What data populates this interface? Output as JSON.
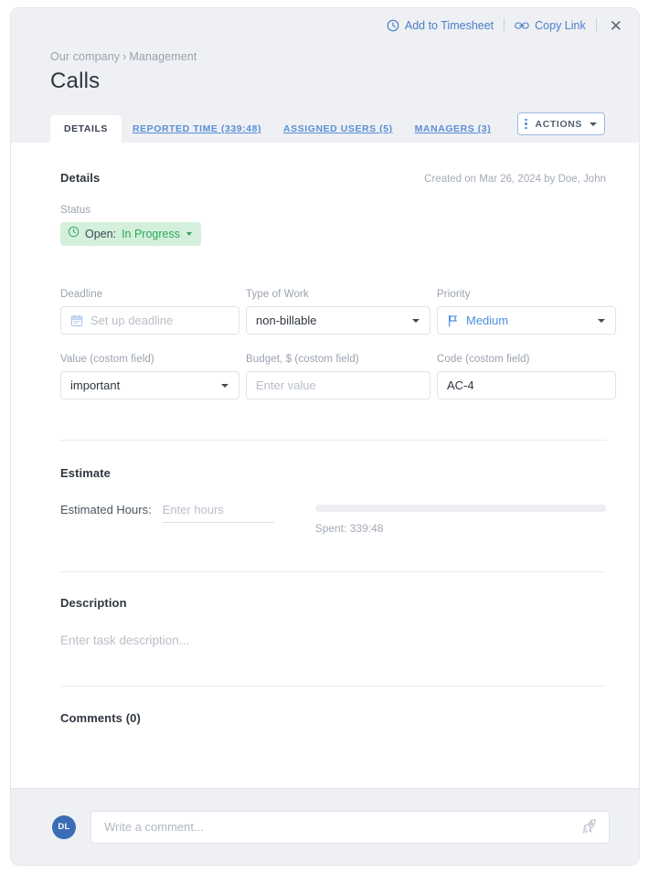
{
  "header": {
    "add_to_timesheet": "Add to Timesheet",
    "copy_link": "Copy Link",
    "close": "✕",
    "breadcrumb": {
      "root": "Our company",
      "separator": "›",
      "leaf": "Management"
    },
    "title": "Calls"
  },
  "tabs": [
    {
      "label": "DETAILS",
      "active": true
    },
    {
      "label": "REPORTED TIME (339:48)",
      "active": false
    },
    {
      "label": "ASSIGNED USERS (5)",
      "active": false
    },
    {
      "label": "MANAGERS (3)",
      "active": false
    }
  ],
  "actions_button": {
    "label": "ACTIONS"
  },
  "details": {
    "section_title": "Details",
    "created_meta": "Created on Mar 26, 2024 by Doe, John",
    "status_label": "Status",
    "status": {
      "prefix": "Open:",
      "value": "In Progress"
    },
    "fields": {
      "deadline": {
        "label": "Deadline",
        "placeholder": "Set up deadline",
        "value": ""
      },
      "type_of_work": {
        "label": "Type of Work",
        "value": "non-billable"
      },
      "priority": {
        "label": "Priority",
        "value": "Medium"
      },
      "value_custom": {
        "label": "Value (costom field)",
        "value": "important"
      },
      "budget_custom": {
        "label": "Budget, $ (costom field)",
        "placeholder": "Enter value",
        "value": ""
      },
      "code_custom": {
        "label": "Code (costom field)",
        "value": "AC-4"
      }
    }
  },
  "estimate": {
    "section_title": "Estimate",
    "hours_label": "Estimated Hours:",
    "hours_placeholder": "Enter hours",
    "hours_value": "",
    "spent_text": "Spent: 339:48",
    "progress_percent": 0
  },
  "description": {
    "section_title": "Description",
    "placeholder": "Enter task description..."
  },
  "comments": {
    "section_title": "Comments (0)",
    "avatar_initials": "DL",
    "input_placeholder": "Write a comment..."
  },
  "colors": {
    "accent_blue": "#4a90e2",
    "link_blue": "#5b8fd4",
    "status_green_bg": "#d4f0dc",
    "status_green_text": "#2aa757",
    "header_bg": "#eef0f4",
    "avatar_bg": "#3b6cb4"
  }
}
